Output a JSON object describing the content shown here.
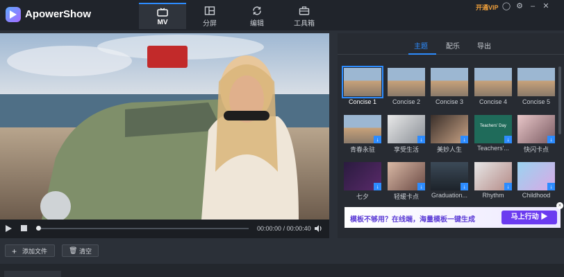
{
  "app": {
    "name": "ApowerShow"
  },
  "nav": {
    "tabs": [
      {
        "label": "MV",
        "icon": "tv-icon"
      },
      {
        "label": "分屏",
        "icon": "split-screen-icon"
      },
      {
        "label": "编辑",
        "icon": "refresh-edit-icon"
      },
      {
        "label": "工具箱",
        "icon": "toolbox-icon"
      }
    ]
  },
  "window": {
    "vip_label": "开通VIP",
    "controls": [
      "user-icon",
      "settings-icon",
      "minimize-icon",
      "close-icon"
    ]
  },
  "player": {
    "time_current": "00:00:00",
    "time_separator": "/",
    "time_total": "00:00:40",
    "progress": 0.0
  },
  "panel": {
    "subtabs": [
      "主题",
      "配乐",
      "导出"
    ],
    "themes": [
      {
        "label": "Concise 1",
        "selected": true
      },
      {
        "label": "Concise 2"
      },
      {
        "label": "Concise 3"
      },
      {
        "label": "Concise 4"
      },
      {
        "label": "Concise 5"
      },
      {
        "label": "青春永驻"
      },
      {
        "label": "享受生活"
      },
      {
        "label": "美妙人生"
      },
      {
        "label": "Teachers'..."
      },
      {
        "label": "快闪卡点"
      },
      {
        "label": "七夕"
      },
      {
        "label": "轻缓卡点"
      },
      {
        "label": "Graduation..."
      },
      {
        "label": "Rhythm"
      },
      {
        "label": "Childhood"
      }
    ],
    "thumb_text": {
      "teachers": "Teachers' Day"
    },
    "banner": {
      "text": "模板不够用？在线端，海量模板一键生成",
      "button": "马上行动 ▶"
    }
  },
  "bottom": {
    "add_file": "添加文件",
    "clear": "清空"
  },
  "colors": {
    "accent": "#2d8cff",
    "vip": "#f3a23b",
    "bg": "#2b3038"
  }
}
